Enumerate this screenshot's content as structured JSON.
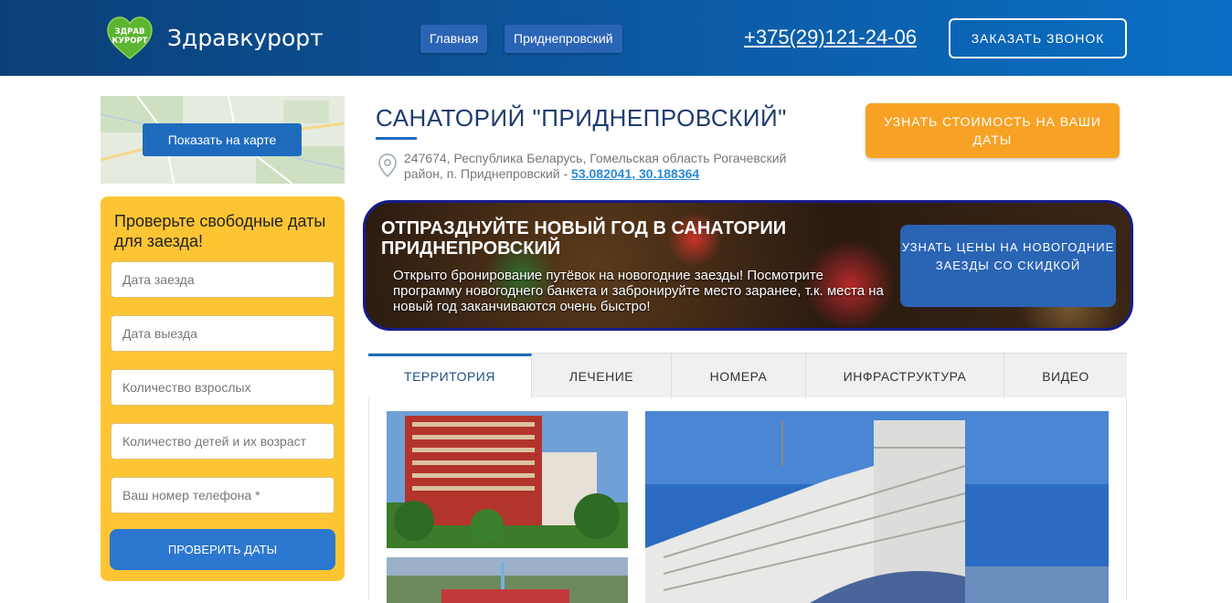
{
  "header": {
    "logo_text": "Здравкурорт",
    "logo_badge_line1": "ЗДРАВ",
    "logo_badge_line2": "КУРОРТ",
    "nav": [
      "Главная",
      "Приднепровский"
    ],
    "phone": "+375(29)121-24-06",
    "callback_label": "ЗАКАЗАТЬ ЗВОНОК"
  },
  "sidebar": {
    "map_button": "Показать на карте",
    "form_title": "Проверьте свободные даты для заезда!",
    "fields": [
      "Дата заезда",
      "Дата выезда",
      "Количество взрослых",
      "Количество детей и их возраст",
      "Ваш номер телефона *"
    ],
    "submit_label": "ПРОВЕРИТЬ ДАТЫ"
  },
  "main": {
    "title": "САНАТОРИЙ \"ПРИДНЕПРОВСКИЙ\"",
    "address": "247674, Республика Беларусь, Гомельская область Рогачевский район, п. Приднепровский - ",
    "coords": "53.082041, 30.188364",
    "price_button": "УЗНАТЬ СТОИМОСТЬ НА ВАШИ ДАТЫ"
  },
  "banner": {
    "title": "ОТПРАЗДНУЙТЕ НОВЫЙ ГОД В САНАТОРИИ ПРИДНЕПРОВСКИЙ",
    "text": "Открыто бронирование путёвок на новогодние заезды! Посмотрите программу новогоднего банкета и забронируйте место заранее, т.к. места на новый год заканчиваются очень быстро!",
    "button": "УЗНАТЬ ЦЕНЫ НА НОВОГОДНИЕ ЗАЕЗДЫ СО СКИДКОЙ"
  },
  "tabs": [
    "ТЕРРИТОРИЯ",
    "ЛЕЧЕНИЕ",
    "НОМЕРА",
    "ИНФРАСТРУКТУРА",
    "ВИДЕО"
  ],
  "colors": {
    "header": "#0c5aa3",
    "accent": "#1e6bbd",
    "form_bg": "#fdc534",
    "price_button": "#f7a224"
  }
}
